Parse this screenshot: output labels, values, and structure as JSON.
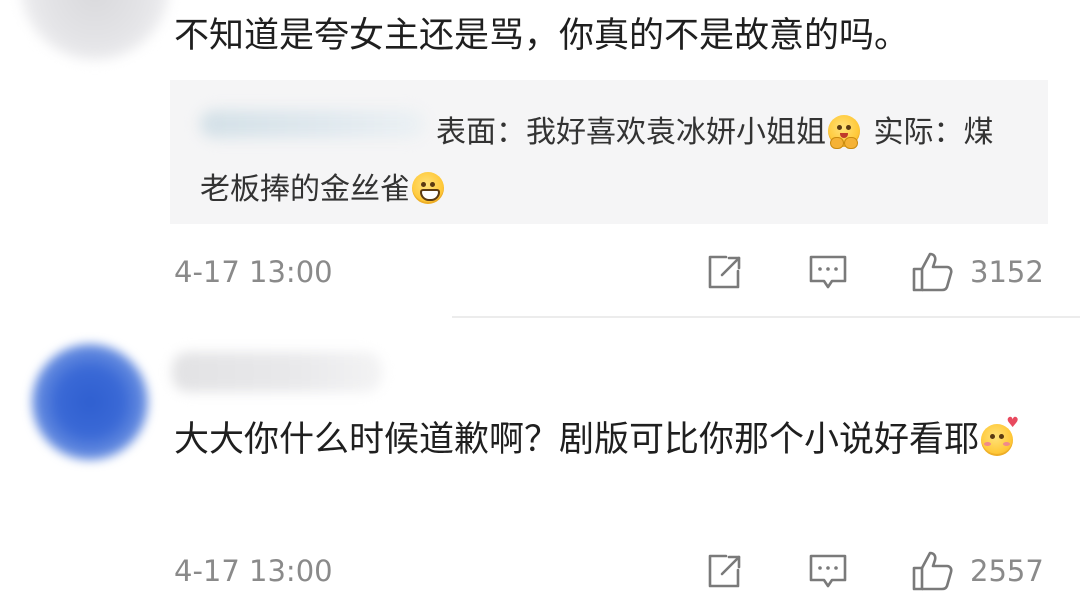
{
  "comments": [
    {
      "text": "不知道是夸女主还是骂，你真的不是故意的吗。",
      "reply": {
        "part1": "表面：我好喜欢袁冰妍小姐姐",
        "part2": " 实际：煤老板捧的金丝雀",
        "emoji1": "hugging-face-emoji",
        "emoji2": "grinning-face-emoji"
      },
      "timestamp": "4-17 13:00",
      "like_count": "3152"
    },
    {
      "text": "大大你什么时候道歉啊？剧版可比你那个小说好看耶",
      "emoji": "smiling-face-with-hearts-emoji",
      "timestamp": "4-17 13:00",
      "like_count": "2557"
    }
  ],
  "icons": {
    "share": "share-icon",
    "reply": "comment-icon",
    "like": "thumbs-up-icon"
  },
  "colors": {
    "text": "#1f1f1f",
    "meta": "#8a8a8a",
    "reply_bg": "#f5f5f6",
    "avatar_blue": "#3a69d6"
  }
}
